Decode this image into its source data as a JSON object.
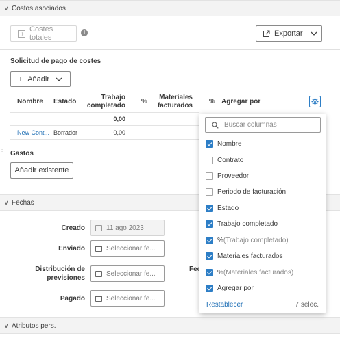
{
  "costos": {
    "header": "Costos asociados",
    "costes_totales": "Costes totales",
    "exportar": "Exportar"
  },
  "solicitud": {
    "title": "Solicitud de pago de costes",
    "add_label": "Añadir"
  },
  "table": {
    "headers": {
      "nombre": "Nombre",
      "estado": "Estado",
      "trabajo_1": "Trabajo",
      "trabajo_2": "completado",
      "pct": "%",
      "materiales_1": "Materiales",
      "materiales_2": "facturados",
      "pct2": "%",
      "agregar": "Agregar por"
    },
    "total_row": {
      "trabajo": "0,00"
    },
    "rows": [
      {
        "nombre": "New Cont...",
        "estado": "Borrador",
        "trabajo": "0,00"
      }
    ]
  },
  "gastos": {
    "title": "Gastos",
    "button": "Añadir existente"
  },
  "fechas": {
    "header": "Fechas",
    "creado_label": "Creado",
    "creado_value": "11 ago 2023",
    "enviado_label": "Enviado",
    "distribucion_label_1": "Distribución de",
    "distribucion_label_2": "previsiones",
    "pagado_label": "Pagado",
    "placeholder": "Seleccionar fe...",
    "partial_label": "Fec"
  },
  "atributos": {
    "header": "Atributos pers."
  },
  "column_picker": {
    "search_placeholder": "Buscar columnas",
    "items": [
      {
        "label": "Nombre",
        "suffix": "",
        "checked": true
      },
      {
        "label": "Contrato",
        "suffix": "",
        "checked": false
      },
      {
        "label": "Proveedor",
        "suffix": "",
        "checked": false
      },
      {
        "label": "Periodo de facturación",
        "suffix": "",
        "checked": false
      },
      {
        "label": "Estado",
        "suffix": "",
        "checked": true
      },
      {
        "label": "Trabajo completado",
        "suffix": "",
        "checked": true
      },
      {
        "label": "%",
        "suffix": " (Trabajo completado)",
        "checked": true
      },
      {
        "label": "Materiales facturados",
        "suffix": "",
        "checked": true
      },
      {
        "label": "%",
        "suffix": " (Materiales facturados)",
        "checked": true
      },
      {
        "label": "Agregar por",
        "suffix": "",
        "checked": true
      }
    ],
    "reset": "Restablecer",
    "count": "7 selec."
  },
  "colors": {
    "accent": "#2d7ec6",
    "link": "#1f6fb5"
  }
}
